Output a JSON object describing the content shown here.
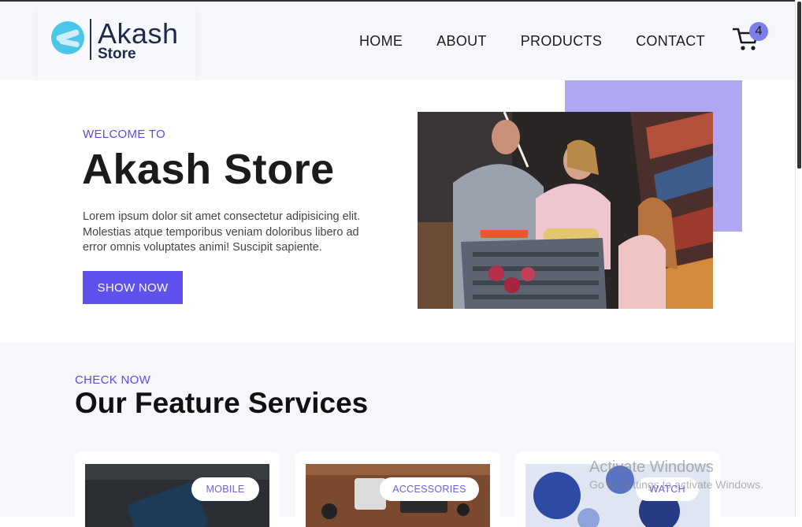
{
  "brand": {
    "name": "Akash",
    "sub": "Store"
  },
  "nav": {
    "items": [
      "HOME",
      "ABOUT",
      "PRODUCTS",
      "CONTACT"
    ]
  },
  "cart": {
    "count": "4"
  },
  "hero": {
    "eyebrow": "WELCOME TO",
    "title": "Akash Store",
    "text": "Lorem ipsum dolor sit amet consectetur adipisicing elit. Molestias atque temporibus veniam doloribus libero ad error omnis voluptates animi! Suscipit sapiente.",
    "button": "SHOW NOW"
  },
  "services": {
    "eyebrow": "CHECK NOW",
    "title": "Our Feature Services",
    "cards": [
      {
        "label": "MOBILE"
      },
      {
        "label": "ACCESSORIES"
      },
      {
        "label": "WATCH"
      }
    ]
  },
  "os_notice": {
    "title": "Activate Windows",
    "text": "Go to Settings to activate Windows."
  },
  "colors": {
    "accent": "#5f51ee",
    "accent_light": "#afa7f2",
    "badge": "#7b7fea",
    "bg_light": "#f6f7fb"
  }
}
